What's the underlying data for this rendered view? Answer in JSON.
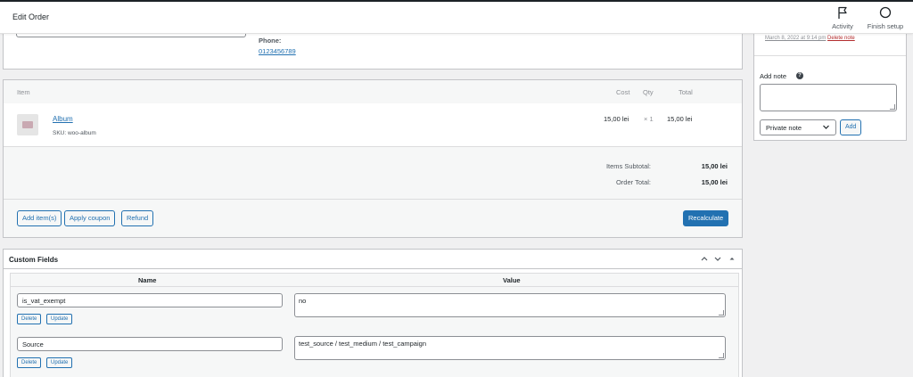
{
  "header": {
    "title": "Edit Order",
    "activity_label": "Activity",
    "finish_label": "Finish setup"
  },
  "address": {
    "phone_label": "Phone:",
    "phone_value": "0123456789"
  },
  "items": {
    "columns": {
      "item": "Item",
      "cost": "Cost",
      "qty": "Qty",
      "total": "Total"
    },
    "rows": [
      {
        "name": "Album",
        "sku": "SKU: woo-album",
        "cost": "15,00 lei",
        "qty": "× 1",
        "total": "15,00 lei"
      }
    ],
    "subtotal_label": "Items Subtotal:",
    "subtotal_value": "15,00 lei",
    "total_label": "Order Total:",
    "total_value": "15,00 lei",
    "buttons": {
      "add_items": "Add item(s)",
      "apply_coupon": "Apply coupon",
      "refund": "Refund",
      "recalculate": "Recalculate"
    }
  },
  "custom_fields": {
    "title": "Custom Fields",
    "col_name": "Name",
    "col_value": "Value",
    "fields": [
      {
        "key": "is_vat_exempt",
        "value": "no"
      },
      {
        "key": "Source",
        "value": "test_source / test_medium / test_campaign"
      }
    ],
    "delete_label": "Delete",
    "update_label": "Update"
  },
  "sidebar": {
    "note_date": "March 8, 2022 at 9:14 pm",
    "delete_note": "Delete note",
    "add_note_label": "Add note",
    "note_type": "Private note",
    "add_button": "Add"
  },
  "colors": {
    "accent": "#2271b1",
    "danger": "#b32d2e",
    "background": "#f0f0f1"
  }
}
